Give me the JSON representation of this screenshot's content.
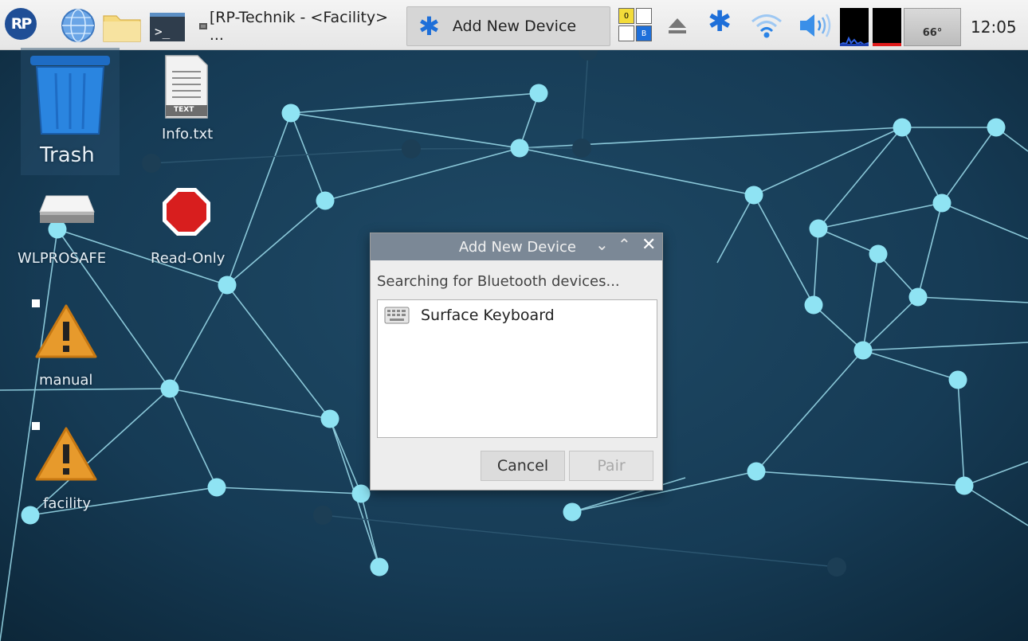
{
  "taskbar": {
    "logo_text": "RP",
    "icons": {
      "browser": "globe-icon",
      "files": "folder-icon",
      "terminal": "terminal-icon",
      "terminal_prompt": ">_"
    },
    "tasks": [
      {
        "label": "[RP-Technik - <Facility> ...",
        "active": false
      },
      {
        "label": "Add New Device",
        "active": true
      }
    ],
    "keyboard_indicator": {
      "o": "O",
      "b": "B"
    },
    "temperature": "66°",
    "clock": "12:05",
    "colors": {
      "bluetooth": "#1e6fd9",
      "indicator_yellow": "#f3dc3a",
      "indicator_blue": "#1e6fd9"
    }
  },
  "desktop": {
    "icons": [
      {
        "label": "Trash",
        "icon": "trash-icon",
        "selected": true
      },
      {
        "label": "Info.txt",
        "icon": "text-file-icon",
        "badge": "TEXT"
      },
      {
        "label": "WLPROSAFE",
        "icon": "drive-icon"
      },
      {
        "label": "Read-Only",
        "icon": "stop-icon"
      },
      {
        "label": "manual",
        "icon": "warning-icon"
      },
      {
        "label": "facility",
        "icon": "warning-icon"
      }
    ]
  },
  "dialog": {
    "title": "Add New Device",
    "controls": {
      "minimize": "⌄",
      "maximize": "⌃",
      "close": "✕"
    },
    "status": "Searching for Bluetooth devices...",
    "devices": [
      {
        "name": "Surface Keyboard",
        "icon": "keyboard-icon"
      }
    ],
    "buttons": {
      "cancel": "Cancel",
      "pair": "Pair"
    }
  }
}
